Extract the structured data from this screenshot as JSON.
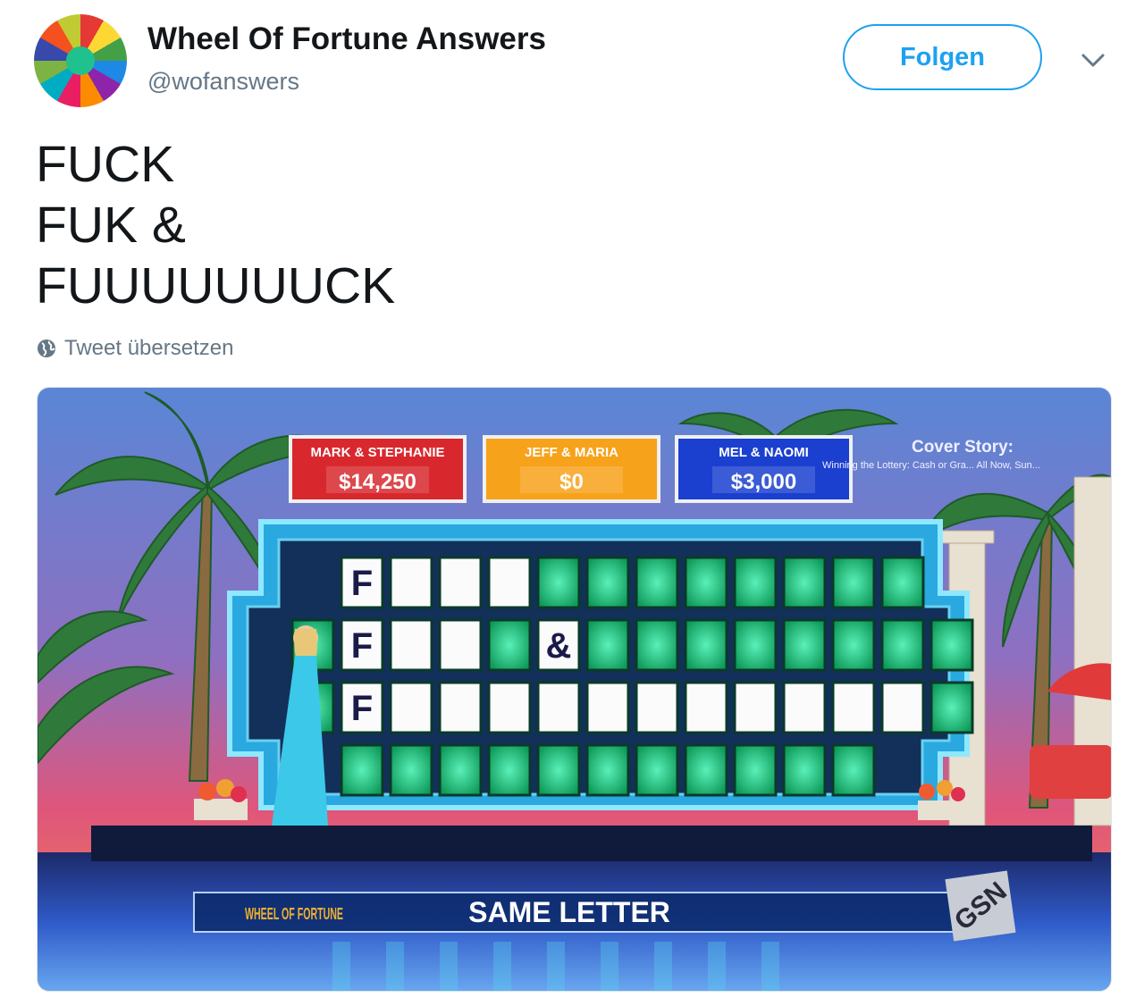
{
  "account": {
    "display_name": "Wheel Of Fortune Answers",
    "handle": "@wofanswers",
    "avatar_icon": "wheel-of-fortune-avatar"
  },
  "follow_button": {
    "label": "Folgen",
    "color": "#1da1f2"
  },
  "menu_icon": "chevron-down-icon",
  "tweet": {
    "lines": [
      "FUCK",
      "FUK &",
      "FUUUUUUUCK"
    ],
    "translate_label": "Tweet übersetzen",
    "translate_icon": "globe-icon"
  },
  "media": {
    "contestants": [
      {
        "names": "MARK & STEPHANIE",
        "score": "$14,250",
        "color": "#d8282e"
      },
      {
        "names": "JEFF & MARIA",
        "score": "$0",
        "color": "#f7a21b"
      },
      {
        "names": "MEL & NAOMI",
        "score": "$3,000",
        "color": "#1b3fcf"
      }
    ],
    "cover_story_title": "Cover Story:",
    "cover_story_text": "Winning the Lottery: Cash or Gra... All Now, Sun...",
    "puzzle_rows": [
      [
        "F",
        "",
        "",
        "",
        "#",
        "#",
        "#",
        "#",
        "#",
        "#",
        "#",
        "#"
      ],
      [
        "F",
        "",
        "",
        "#",
        "&",
        "#",
        "#",
        "#",
        "#",
        "#",
        "#",
        "#"
      ],
      [
        "F",
        "",
        "",
        "",
        "",
        "",
        "",
        "",
        "",
        "",
        "",
        ""
      ]
    ],
    "category": "SAME LETTER",
    "show_logo": "WHEEL OF FORTUNE",
    "network_logo": "GSN"
  }
}
